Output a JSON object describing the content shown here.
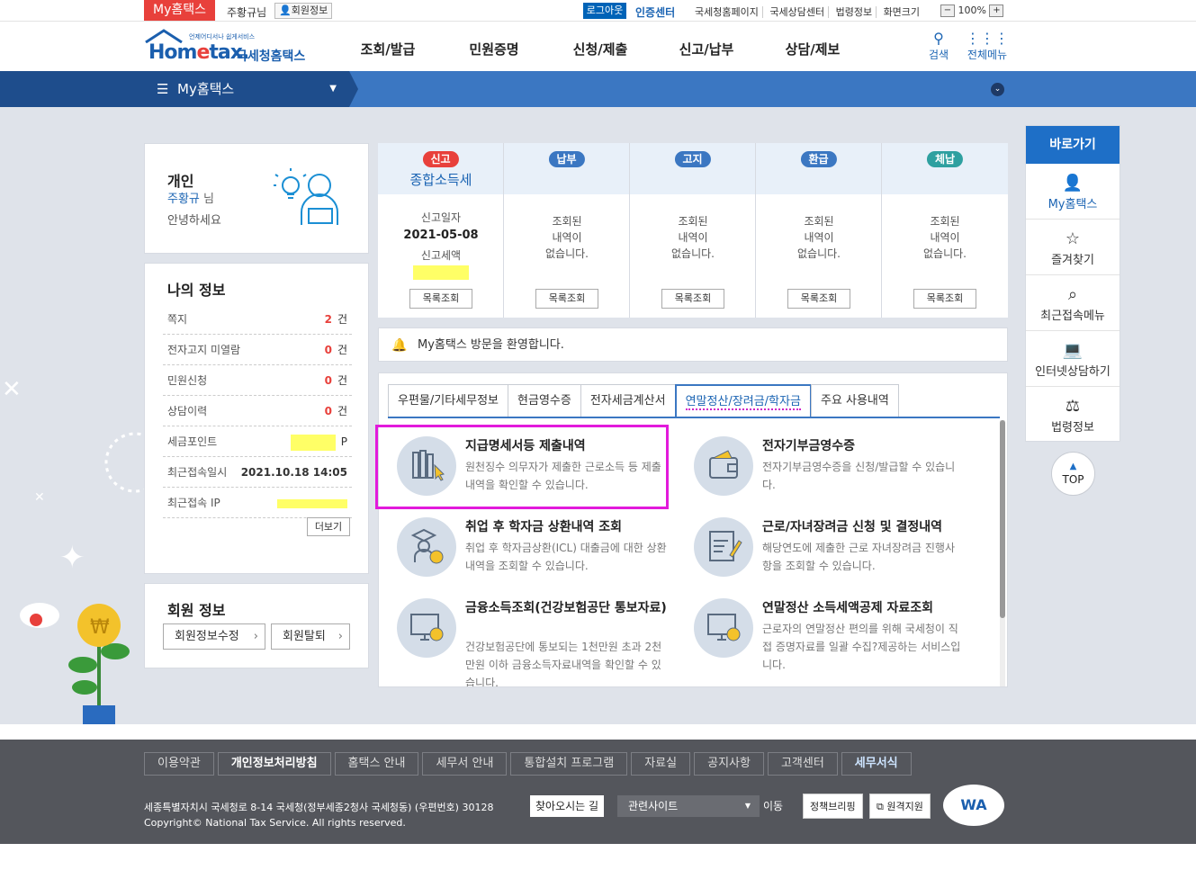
{
  "topbar": {
    "my_tab": "My홈택스",
    "user": "주황규님",
    "member_info": "회원정보",
    "logout": "로그아웃",
    "cert_center": "인증센터",
    "links": [
      "국세청홈페이지",
      "국세상담센터",
      "법령정보",
      "화면크기"
    ],
    "zoom_minus": "−",
    "zoom_value": "100%",
    "zoom_plus": "+"
  },
  "header": {
    "logo_small": "언제어디서나 쉽게서비스",
    "logo_en_left": "Hom",
    "logo_en_e": "e",
    "logo_en_right": "tax.",
    "logo_ko": "국세청홈택스",
    "menu": [
      "조회/발급",
      "민원증명",
      "신청/제출",
      "신고/납부",
      "상담/제보"
    ],
    "search": "검색",
    "all_menu": "전체메뉴"
  },
  "navbar": {
    "current": "My홈택스"
  },
  "greeting": {
    "type": "개인",
    "name": "주황규",
    "suffix": "님",
    "hello": "안녕하세요"
  },
  "my_info": {
    "title": "나의 정보",
    "rows": [
      {
        "label": "쪽지",
        "value": "2",
        "unit": "건"
      },
      {
        "label": "전자고지 미열람",
        "value": "0",
        "unit": "건"
      },
      {
        "label": "민원신청",
        "value": "0",
        "unit": "건"
      },
      {
        "label": "상담이력",
        "value": "0",
        "unit": "건"
      }
    ],
    "point_label": "세금포인트",
    "point_unit": "P",
    "last_login_label": "최근접속일시",
    "last_login_value": "2021.10.18 14:05",
    "last_ip_label": "최근접속 IP",
    "more": "더보기"
  },
  "member": {
    "title": "회원 정보",
    "edit": "회원정보수정",
    "withdraw": "회원탈퇴"
  },
  "status": {
    "badges": [
      {
        "label": "신고",
        "color": "#e8403b"
      },
      {
        "label": "납부",
        "color": "#3b77c2"
      },
      {
        "label": "고지",
        "color": "#3b77c2"
      },
      {
        "label": "환급",
        "color": "#3b77c2"
      },
      {
        "label": "체납",
        "color": "#2ea0a0"
      }
    ],
    "first_sub": "종합소득세",
    "first_date_label": "신고일자",
    "first_date": "2021-05-08",
    "first_amount_label": "신고세액",
    "empty_line1": "조회된",
    "empty_line2": "내역이",
    "empty_line3": "없습니다.",
    "list_btn": "목록조회"
  },
  "notice": "My홈택스 방문을 환영합니다.",
  "tabs": [
    "우편물/기타세무정보",
    "현금영수증",
    "전자세금계산서",
    "연말정산/장려금/학자금",
    "주요 사용내역"
  ],
  "services": [
    {
      "title": "지급명세서등 제출내역",
      "desc": "원천징수 의무자가 제출한 근로소득 등 제출내역을 확인할 수 있습니다."
    },
    {
      "title": "전자기부금영수증",
      "desc": "전자기부금영수증을 신청/발급할 수 있습니다."
    },
    {
      "title": "취업 후 학자금 상환내역 조회",
      "desc": "취업 후 학자금상환(ICL) 대출금에 대한 상환내역을 조회할 수 있습니다."
    },
    {
      "title": "근로/자녀장려금 신청 및 결정내역",
      "desc": "해당연도에 제출한 근로 자녀장려금 진행사항을 조회할 수 있습니다."
    },
    {
      "title": "금융소득조회(건강보험공단 통보자료)",
      "desc": "건강보험공단에 통보되는 1천만원 초과 2천만원 이하 금융소득자료내역을 확인할 수 있습니다."
    },
    {
      "title": "연말정산 소득세액공제 자료조회",
      "desc": "근로자의 연말정산 편의를 위해 국세청이 직접 증명자료를 일괄 수집?제공하는 서비스입니다."
    }
  ],
  "quick": {
    "title": "바로가기",
    "items": [
      "My홈택스",
      "즐겨찾기",
      "최근접속메뉴",
      "인터넷상담하기",
      "법령정보"
    ],
    "top": "TOP"
  },
  "footer": {
    "links": [
      "이용약관",
      "개인정보처리방침",
      "홈택스 안내",
      "세무서 안내",
      "통합설치 프로그램",
      "자료실",
      "공지사항",
      "고객센터",
      "세무서식"
    ],
    "address": "세종특별자치시 국세청로 8-14 국세청(정부세종2청사 국세청동) (우편번호) 30128",
    "find": "찾아오시는 길",
    "copyright": "Copyright© National Tax Service. All rights reserved.",
    "related": "관련사이트",
    "go": "이동",
    "policy": "정책브리핑",
    "remote": "원격지원",
    "wa": "WA"
  }
}
